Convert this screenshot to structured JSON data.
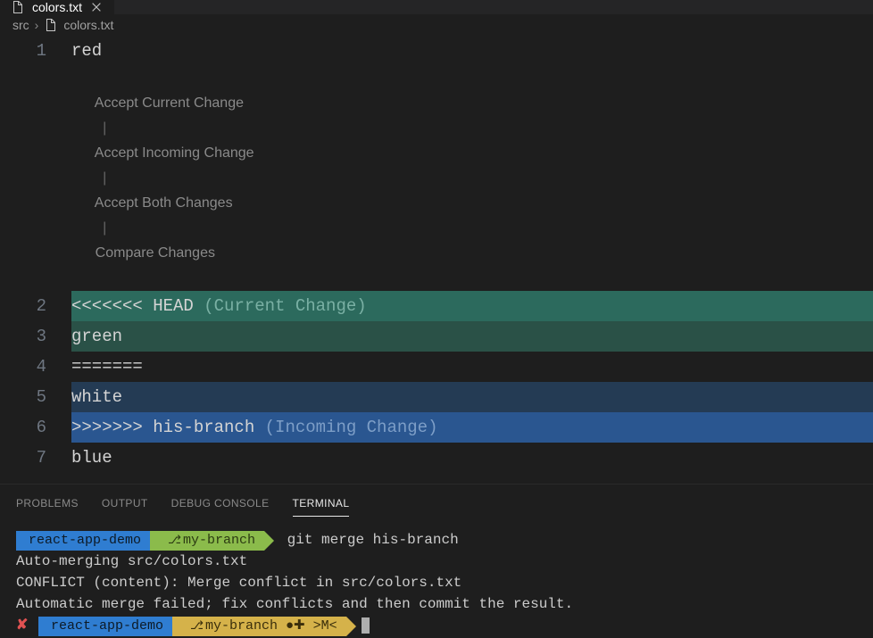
{
  "tab": {
    "filename": "colors.txt"
  },
  "breadcrumbs": {
    "folder": "src",
    "file": "colors.txt"
  },
  "codelens": {
    "accept_current": "Accept Current Change",
    "accept_incoming": "Accept Incoming Change",
    "accept_both": "Accept Both Changes",
    "compare": "Compare Changes"
  },
  "lines": {
    "l1": {
      "num": "1",
      "text": "red"
    },
    "l2": {
      "num": "2",
      "marker": "<<<<<<< HEAD",
      "label": "(Current Change)"
    },
    "l3": {
      "num": "3",
      "text": "green"
    },
    "l4": {
      "num": "4",
      "text": "======="
    },
    "l5": {
      "num": "5",
      "text": "white"
    },
    "l6": {
      "num": "6",
      "marker": ">>>>>>> his-branch",
      "label": "(Incoming Change)"
    },
    "l7": {
      "num": "7",
      "text": "blue"
    }
  },
  "panel": {
    "tabs": {
      "problems": "PROBLEMS",
      "output": "OUTPUT",
      "debug": "DEBUG CONSOLE",
      "terminal": "TERMINAL"
    }
  },
  "terminal": {
    "prompt1": {
      "project": "react-app-demo",
      "branch": "my-branch",
      "cmd": "git merge his-branch"
    },
    "out1": "Auto-merging src/colors.txt",
    "out2": "CONFLICT (content): Merge conflict in src/colors.txt",
    "out3": "Automatic merge failed; fix conflicts and then commit the result.",
    "prompt2": {
      "x": "✘",
      "project": "react-app-demo",
      "branch": "my-branch ●✚ >M<"
    }
  }
}
